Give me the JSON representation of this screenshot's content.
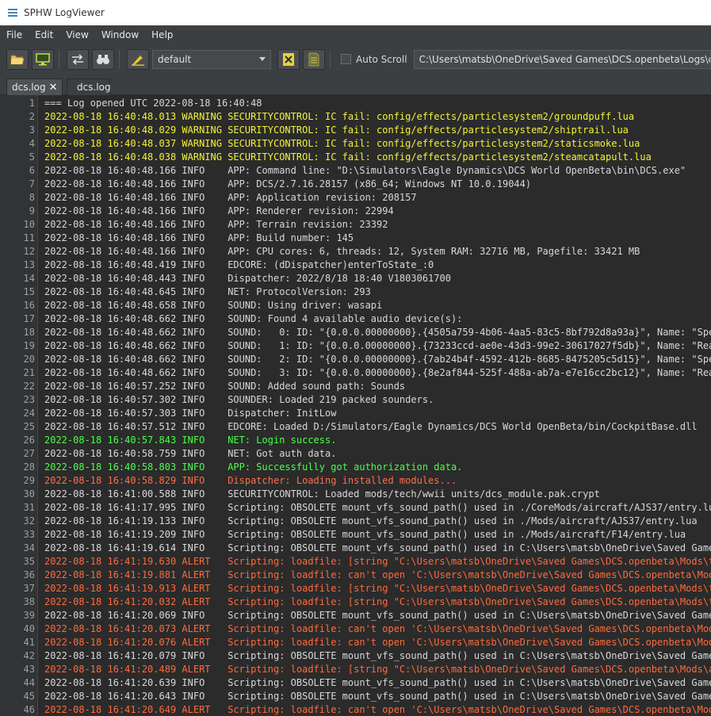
{
  "window": {
    "title": "SPHW LogViewer"
  },
  "menu": [
    {
      "key": "file",
      "label": "File"
    },
    {
      "key": "edit",
      "label": "Edit"
    },
    {
      "key": "view",
      "label": "View"
    },
    {
      "key": "window",
      "label": "Window"
    },
    {
      "key": "help",
      "label": "Help"
    }
  ],
  "toolbar": {
    "profile_value": "default",
    "autoscroll_label": "Auto Scroll",
    "autoscroll_checked": false,
    "path_value": "C:\\Users\\matsb\\OneDrive\\Saved Games\\DCS.openbeta\\Logs\\dcs.log",
    "icons": [
      "open-folder-icon",
      "monitor-icon",
      "swap-arrows-icon",
      "binoculars-icon",
      "highlighter-icon",
      "excel-export-icon",
      "text-export-icon"
    ]
  },
  "tabs": [
    {
      "label": "dcs.log",
      "active": true,
      "closable": true
    },
    {
      "label": "dcs.log",
      "active": false,
      "closable": false
    }
  ],
  "colors": {
    "info": "#d8d8d8",
    "warning": "#f2f23a",
    "success": "#49ff49",
    "error": "#ff6e4a",
    "alert": "#ff6a3c"
  },
  "log_lines": [
    {
      "n": "1",
      "level": "info",
      "text": "=== Log opened UTC 2022-08-18 16:40:48"
    },
    {
      "n": "2",
      "level": "warning",
      "text": "2022-08-18 16:40:48.013 WARNING SECURITYCONTROL: IC fail: config/effects/particlesystem2/groundpuff.lua"
    },
    {
      "n": "3",
      "level": "warning",
      "text": "2022-08-18 16:40:48.029 WARNING SECURITYCONTROL: IC fail: config/effects/particlesystem2/shiptrail.lua"
    },
    {
      "n": "4",
      "level": "warning",
      "text": "2022-08-18 16:40:48.037 WARNING SECURITYCONTROL: IC fail: config/effects/particlesystem2/staticsmoke.lua"
    },
    {
      "n": "5",
      "level": "warning",
      "text": "2022-08-18 16:40:48.038 WARNING SECURITYCONTROL: IC fail: config/effects/particlesystem2/steamcatapult.lua"
    },
    {
      "n": "6",
      "level": "info",
      "text": "2022-08-18 16:40:48.166 INFO    APP: Command line: \"D:\\Simulators\\Eagle Dynamics\\DCS World OpenBeta\\bin\\DCS.exe\""
    },
    {
      "n": "7",
      "level": "info",
      "text": "2022-08-18 16:40:48.166 INFO    APP: DCS/2.7.16.28157 (x86_64; Windows NT 10.0.19044)"
    },
    {
      "n": "8",
      "level": "info",
      "text": "2022-08-18 16:40:48.166 INFO    APP: Application revision: 208157"
    },
    {
      "n": "9",
      "level": "info",
      "text": "2022-08-18 16:40:48.166 INFO    APP: Renderer revision: 22994"
    },
    {
      "n": "10",
      "level": "info",
      "text": "2022-08-18 16:40:48.166 INFO    APP: Terrain revision: 23392"
    },
    {
      "n": "11",
      "level": "info",
      "text": "2022-08-18 16:40:48.166 INFO    APP: Build number: 145"
    },
    {
      "n": "12",
      "level": "info",
      "text": "2022-08-18 16:40:48.166 INFO    APP: CPU cores: 6, threads: 12, System RAM: 32716 MB, Pagefile: 33421 MB"
    },
    {
      "n": "13",
      "level": "info",
      "text": "2022-08-18 16:40:48.419 INFO    EDCORE: (dDispatcher)enterToState_:0"
    },
    {
      "n": "14",
      "level": "info",
      "text": "2022-08-18 16:40:48.443 INFO    Dispatcher: 2022/8/18 18:40 V1803061700"
    },
    {
      "n": "15",
      "level": "info",
      "text": "2022-08-18 16:40:48.645 INFO    NET: ProtocolVersion: 293"
    },
    {
      "n": "16",
      "level": "info",
      "text": "2022-08-18 16:40:48.658 INFO    SOUND: Using driver: wasapi"
    },
    {
      "n": "17",
      "level": "info",
      "text": "2022-08-18 16:40:48.662 INFO    SOUND: Found 4 available audio device(s):"
    },
    {
      "n": "18",
      "level": "info",
      "text": "2022-08-18 16:40:48.662 INFO    SOUND:   0: ID: \"{0.0.0.00000000}.{4505a759-4b06-4aa5-83c5-8bf792d8a93a}\", Name: \"Spea"
    },
    {
      "n": "19",
      "level": "info",
      "text": "2022-08-18 16:40:48.662 INFO    SOUND:   1: ID: \"{0.0.0.00000000}.{73233ccd-ae0e-43d3-99e2-30617027f5db}\", Name: \"Real"
    },
    {
      "n": "20",
      "level": "info",
      "text": "2022-08-18 16:40:48.662 INFO    SOUND:   2: ID: \"{0.0.0.00000000}.{7ab24b4f-4592-412b-8685-8475205c5d15}\", Name: \"Spea"
    },
    {
      "n": "21",
      "level": "info",
      "text": "2022-08-18 16:40:48.662 INFO    SOUND:   3: ID: \"{0.0.0.00000000}.{8e2af844-525f-488a-ab7a-e7e16cc2bc12}\", Name: \"Real"
    },
    {
      "n": "22",
      "level": "info",
      "text": "2022-08-18 16:40:57.252 INFO    SOUND: Added sound path: Sounds"
    },
    {
      "n": "23",
      "level": "info",
      "text": "2022-08-18 16:40:57.302 INFO    SOUNDER: Loaded 219 packed sounders."
    },
    {
      "n": "24",
      "level": "info",
      "text": "2022-08-18 16:40:57.303 INFO    Dispatcher: InitLow"
    },
    {
      "n": "25",
      "level": "info",
      "text": "2022-08-18 16:40:57.512 INFO    EDCORE: Loaded D:/Simulators/Eagle Dynamics/DCS World OpenBeta/bin/CockpitBase.dll"
    },
    {
      "n": "26",
      "level": "success",
      "text": "2022-08-18 16:40:57.843 INFO    NET: Login success."
    },
    {
      "n": "27",
      "level": "info",
      "text": "2022-08-18 16:40:58.759 INFO    NET: Got auth data."
    },
    {
      "n": "28",
      "level": "success",
      "text": "2022-08-18 16:40:58.803 INFO    APP: Successfully got authorization data."
    },
    {
      "n": "29",
      "level": "error",
      "text": "2022-08-18 16:40:58.829 INFO    Dispatcher: Loading installed modules..."
    },
    {
      "n": "30",
      "level": "info",
      "text": "2022-08-18 16:41:00.588 INFO    SECURITYCONTROL: Loaded mods/tech/wwii units/dcs_module.pak.crypt"
    },
    {
      "n": "31",
      "level": "info",
      "text": "2022-08-18 16:41:17.995 INFO    Scripting: OBSOLETE mount_vfs_sound_path() used in ./CoreMods/aircraft/AJS37/entry.lua"
    },
    {
      "n": "32",
      "level": "info",
      "text": "2022-08-18 16:41:19.133 INFO    Scripting: OBSOLETE mount_vfs_sound_path() used in ./Mods/aircraft/AJS37/entry.lua"
    },
    {
      "n": "33",
      "level": "info",
      "text": "2022-08-18 16:41:19.209 INFO    Scripting: OBSOLETE mount_vfs_sound_path() used in ./Mods/aircraft/F14/entry.lua"
    },
    {
      "n": "34",
      "level": "info",
      "text": "2022-08-18 16:41:19.614 INFO    Scripting: OBSOLETE mount_vfs_sound_path() used in C:\\Users\\matsb\\OneDrive\\Saved Games"
    },
    {
      "n": "35",
      "level": "alert",
      "text": "2022-08-18 16:41:19.630 ALERT   Scripting: loadfile: [string \"C:\\Users\\matsb\\OneDrive\\Saved Games\\DCS.openbeta\\Mods\\te"
    },
    {
      "n": "36",
      "level": "alert",
      "text": "2022-08-18 16:41:19.881 ALERT   Scripting: loadfile: can't open 'C:\\Users\\matsb\\OneDrive\\Saved Games\\DCS.openbeta\\Mods"
    },
    {
      "n": "37",
      "level": "alert",
      "text": "2022-08-18 16:41:19.913 ALERT   Scripting: loadfile: [string \"C:\\Users\\matsb\\OneDrive\\Saved Games\\DCS.openbeta\\Mods\\te"
    },
    {
      "n": "38",
      "level": "alert",
      "text": "2022-08-18 16:41:20.032 ALERT   Scripting: loadfile: [string \"C:\\Users\\matsb\\OneDrive\\Saved Games\\DCS.openbeta\\Mods\\te"
    },
    {
      "n": "39",
      "level": "info",
      "text": "2022-08-18 16:41:20.069 INFO    Scripting: OBSOLETE mount_vfs_sound_path() used in C:\\Users\\matsb\\OneDrive\\Saved Games"
    },
    {
      "n": "40",
      "level": "alert",
      "text": "2022-08-18 16:41:20.073 ALERT   Scripting: loadfile: can't open 'C:\\Users\\matsb\\OneDrive\\Saved Games\\DCS.openbeta\\Mods"
    },
    {
      "n": "41",
      "level": "alert",
      "text": "2022-08-18 16:41:20.076 ALERT   Scripting: loadfile: can't open 'C:\\Users\\matsb\\OneDrive\\Saved Games\\DCS.openbeta\\Mods"
    },
    {
      "n": "42",
      "level": "info",
      "text": "2022-08-18 16:41:20.079 INFO    Scripting: OBSOLETE mount_vfs_sound_path() used in C:\\Users\\matsb\\OneDrive\\Saved Games"
    },
    {
      "n": "43",
      "level": "alert",
      "text": "2022-08-18 16:41:20.489 ALERT   Scripting: loadfile: [string \"C:\\Users\\matsb\\OneDrive\\Saved Games\\DCS.openbeta\\Mods\\ai"
    },
    {
      "n": "44",
      "level": "info",
      "text": "2022-08-18 16:41:20.639 INFO    Scripting: OBSOLETE mount_vfs_sound_path() used in C:\\Users\\matsb\\OneDrive\\Saved Games"
    },
    {
      "n": "45",
      "level": "info",
      "text": "2022-08-18 16:41:20.643 INFO    Scripting: OBSOLETE mount_vfs_sound_path() used in C:\\Users\\matsb\\OneDrive\\Saved Games"
    },
    {
      "n": "46",
      "level": "alert",
      "text": "2022-08-18 16:41:20.649 ALERT   Scripting: loadfile: can't open 'C:\\Users\\matsb\\OneDrive\\Saved Games\\DCS.openbeta\\Mods"
    }
  ]
}
